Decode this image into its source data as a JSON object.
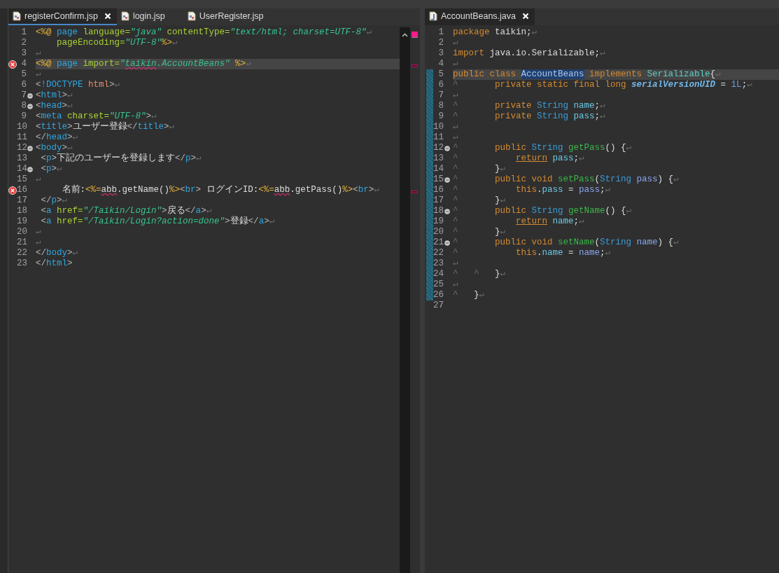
{
  "editors": [
    {
      "focused": true,
      "tabs": [
        {
          "label": "registerConfirm.jsp",
          "kind": "jsp",
          "selected": true
        },
        {
          "label": "login.jsp",
          "kind": "jsp",
          "selected": false
        },
        {
          "label": "UserRegister.jsp",
          "kind": "jsp",
          "selected": false
        }
      ],
      "lines": [
        {
          "number": "1",
          "error": false,
          "fold": false,
          "current": false,
          "tokens": [
            {
              "text": "<%@",
              "kind": "dir"
            },
            {
              "text": " page",
              "kind": "tag"
            },
            {
              "text": " language=",
              "kind": "attr"
            },
            {
              "text": "\"java\"",
              "kind": "value"
            },
            {
              "text": " contentType=",
              "kind": "attr"
            },
            {
              "text": "\"text/html; charset=UTF-8\"",
              "kind": "value"
            },
            {
              "text": "↵",
              "kind": "ws"
            }
          ]
        },
        {
          "number": "2",
          "error": false,
          "fold": false,
          "current": false,
          "tokens": [
            {
              "text": "    pageEncoding=",
              "kind": "attr"
            },
            {
              "text": "\"UTF-8\"",
              "kind": "value"
            },
            {
              "text": "%>",
              "kind": "dir"
            },
            {
              "text": "↵",
              "kind": "ws"
            }
          ]
        },
        {
          "number": "3",
          "error": false,
          "fold": false,
          "current": false,
          "tokens": [
            {
              "text": "↵",
              "kind": "ws"
            }
          ]
        },
        {
          "number": "4",
          "error": true,
          "fold": false,
          "current": true,
          "tokens": [
            {
              "text": "<%@",
              "kind": "dir"
            },
            {
              "text": " page",
              "kind": "tag"
            },
            {
              "text": " import=",
              "kind": "attr"
            },
            {
              "text": "\"",
              "kind": "value"
            },
            {
              "text": "taikin",
              "kind": "value_err"
            },
            {
              "text": ".AccountBeans\"",
              "kind": "value"
            },
            {
              "text": " %>",
              "kind": "dir"
            },
            {
              "text": "↵",
              "kind": "ws"
            }
          ]
        },
        {
          "number": "5",
          "error": false,
          "fold": false,
          "current": false,
          "tokens": [
            {
              "text": "↵",
              "kind": "ws"
            }
          ]
        },
        {
          "number": "6",
          "error": false,
          "fold": false,
          "current": false,
          "tokens": [
            {
              "text": "<",
              "kind": "punct"
            },
            {
              "text": "!DOCTYPE",
              "kind": "tag"
            },
            {
              "text": " html",
              "kind": "doctype"
            },
            {
              "text": ">",
              "kind": "punct"
            },
            {
              "text": "↵",
              "kind": "ws"
            }
          ]
        },
        {
          "number": "7",
          "error": false,
          "fold": true,
          "current": false,
          "tokens": [
            {
              "text": "<",
              "kind": "punct"
            },
            {
              "text": "html",
              "kind": "tag"
            },
            {
              "text": ">",
              "kind": "punct"
            },
            {
              "text": "↵",
              "kind": "ws"
            }
          ]
        },
        {
          "number": "8",
          "error": false,
          "fold": true,
          "current": false,
          "tokens": [
            {
              "text": "<",
              "kind": "punct"
            },
            {
              "text": "head",
              "kind": "tag"
            },
            {
              "text": ">",
              "kind": "punct"
            },
            {
              "text": "↵",
              "kind": "ws"
            }
          ]
        },
        {
          "number": "9",
          "error": false,
          "fold": false,
          "current": false,
          "tokens": [
            {
              "text": "<",
              "kind": "punct"
            },
            {
              "text": "meta",
              "kind": "tag"
            },
            {
              "text": " charset=",
              "kind": "attr"
            },
            {
              "text": "\"UTF-8\"",
              "kind": "value"
            },
            {
              "text": ">",
              "kind": "punct"
            },
            {
              "text": "↵",
              "kind": "ws"
            }
          ]
        },
        {
          "number": "10",
          "error": false,
          "fold": false,
          "current": false,
          "tokens": [
            {
              "text": "<",
              "kind": "punct"
            },
            {
              "text": "title",
              "kind": "tag"
            },
            {
              "text": ">",
              "kind": "punct"
            },
            {
              "text": "ユーザー登録",
              "kind": "plain"
            },
            {
              "text": "</",
              "kind": "punct"
            },
            {
              "text": "title",
              "kind": "tag"
            },
            {
              "text": ">",
              "kind": "punct"
            },
            {
              "text": "↵",
              "kind": "ws"
            }
          ]
        },
        {
          "number": "11",
          "error": false,
          "fold": false,
          "current": false,
          "tokens": [
            {
              "text": "</",
              "kind": "punct"
            },
            {
              "text": "head",
              "kind": "tag"
            },
            {
              "text": ">",
              "kind": "punct"
            },
            {
              "text": "↵",
              "kind": "ws"
            }
          ]
        },
        {
          "number": "12",
          "error": false,
          "fold": true,
          "current": false,
          "tokens": [
            {
              "text": "<",
              "kind": "punct"
            },
            {
              "text": "body",
              "kind": "tag"
            },
            {
              "text": ">",
              "kind": "punct"
            },
            {
              "text": "↵",
              "kind": "ws"
            }
          ]
        },
        {
          "number": "13",
          "error": false,
          "fold": false,
          "current": false,
          "tokens": [
            {
              "text": " <",
              "kind": "punct"
            },
            {
              "text": "p",
              "kind": "tag"
            },
            {
              "text": ">",
              "kind": "punct"
            },
            {
              "text": "下記のユーザーを登録します",
              "kind": "plain"
            },
            {
              "text": "</",
              "kind": "punct"
            },
            {
              "text": "p",
              "kind": "tag"
            },
            {
              "text": ">",
              "kind": "punct"
            },
            {
              "text": "↵",
              "kind": "ws"
            }
          ]
        },
        {
          "number": "14",
          "error": false,
          "fold": true,
          "current": false,
          "tokens": [
            {
              "text": " <",
              "kind": "punct"
            },
            {
              "text": "p",
              "kind": "tag"
            },
            {
              "text": ">",
              "kind": "punct"
            },
            {
              "text": "↵",
              "kind": "ws"
            }
          ]
        },
        {
          "number": "15",
          "error": false,
          "fold": false,
          "current": false,
          "tokens": [
            {
              "text": "↵",
              "kind": "ws"
            }
          ]
        },
        {
          "number": "16",
          "error": true,
          "fold": false,
          "current": false,
          "tokens": [
            {
              "text": "     名前:",
              "kind": "plain"
            },
            {
              "text": "<%=",
              "kind": "dir"
            },
            {
              "text": "abb",
              "kind": "text_err"
            },
            {
              "text": ".getName()",
              "kind": "plain"
            },
            {
              "text": "%>",
              "kind": "dir"
            },
            {
              "text": "<",
              "kind": "punct"
            },
            {
              "text": "br",
              "kind": "tag"
            },
            {
              "text": ">",
              "kind": "punct"
            },
            {
              "text": " ログインID:",
              "kind": "plain"
            },
            {
              "text": "<%=",
              "kind": "dir"
            },
            {
              "text": "abb",
              "kind": "text_err"
            },
            {
              "text": ".getPass()",
              "kind": "plain"
            },
            {
              "text": "%>",
              "kind": "dir"
            },
            {
              "text": "<",
              "kind": "punct"
            },
            {
              "text": "br",
              "kind": "tag"
            },
            {
              "text": ">",
              "kind": "punct"
            },
            {
              "text": "↵",
              "kind": "ws"
            }
          ]
        },
        {
          "number": "17",
          "error": false,
          "fold": false,
          "current": false,
          "tokens": [
            {
              "text": " </",
              "kind": "punct"
            },
            {
              "text": "p",
              "kind": "tag"
            },
            {
              "text": ">",
              "kind": "punct"
            },
            {
              "text": "↵",
              "kind": "ws"
            }
          ]
        },
        {
          "number": "18",
          "error": false,
          "fold": false,
          "current": false,
          "tokens": [
            {
              "text": " <",
              "kind": "punct"
            },
            {
              "text": "a",
              "kind": "tag"
            },
            {
              "text": " href=",
              "kind": "attr"
            },
            {
              "text": "\"/Taikin/Login\"",
              "kind": "value"
            },
            {
              "text": ">",
              "kind": "punct"
            },
            {
              "text": "戻る",
              "kind": "plain"
            },
            {
              "text": "</",
              "kind": "punct"
            },
            {
              "text": "a",
              "kind": "tag"
            },
            {
              "text": ">",
              "kind": "punct"
            },
            {
              "text": "↵",
              "kind": "ws"
            }
          ]
        },
        {
          "number": "19",
          "error": false,
          "fold": false,
          "current": false,
          "tokens": [
            {
              "text": " <",
              "kind": "punct"
            },
            {
              "text": "a",
              "kind": "tag"
            },
            {
              "text": " href=",
              "kind": "attr"
            },
            {
              "text": "\"/Taikin/Login?action=done\"",
              "kind": "value"
            },
            {
              "text": ">",
              "kind": "punct"
            },
            {
              "text": "登録",
              "kind": "plain"
            },
            {
              "text": "</",
              "kind": "punct"
            },
            {
              "text": "a",
              "kind": "tag"
            },
            {
              "text": ">",
              "kind": "punct"
            },
            {
              "text": "↵",
              "kind": "ws"
            }
          ]
        },
        {
          "number": "20",
          "error": false,
          "fold": false,
          "current": false,
          "tokens": [
            {
              "text": "↵",
              "kind": "ws"
            }
          ]
        },
        {
          "number": "21",
          "error": false,
          "fold": false,
          "current": false,
          "tokens": [
            {
              "text": "↵",
              "kind": "ws"
            }
          ]
        },
        {
          "number": "22",
          "error": false,
          "fold": false,
          "current": false,
          "tokens": [
            {
              "text": "</",
              "kind": "punct"
            },
            {
              "text": "body",
              "kind": "tag"
            },
            {
              "text": ">",
              "kind": "punct"
            },
            {
              "text": "↵",
              "kind": "ws"
            }
          ]
        },
        {
          "number": "23",
          "error": false,
          "fold": false,
          "current": false,
          "tokens": [
            {
              "text": "</",
              "kind": "punct"
            },
            {
              "text": "html",
              "kind": "tag"
            },
            {
              "text": ">",
              "kind": "punct"
            }
          ]
        }
      ]
    },
    {
      "focused": false,
      "tabs": [
        {
          "label": "AccountBeans.java",
          "kind": "java",
          "selected": true
        }
      ],
      "lines": [
        {
          "number": "1",
          "fold": false,
          "current": false,
          "changed": false,
          "tokens": [
            {
              "text": "package",
              "kind": "keyword"
            },
            {
              "text": " taikin;",
              "kind": "plain"
            },
            {
              "text": "↵",
              "kind": "ws"
            }
          ]
        },
        {
          "number": "2",
          "fold": false,
          "current": false,
          "changed": false,
          "tokens": [
            {
              "text": "↵",
              "kind": "ws"
            }
          ]
        },
        {
          "number": "3",
          "fold": false,
          "current": false,
          "changed": false,
          "tokens": [
            {
              "text": "import",
              "kind": "keyword"
            },
            {
              "text": " java.io.Serializable;",
              "kind": "plain"
            },
            {
              "text": "↵",
              "kind": "ws"
            }
          ]
        },
        {
          "number": "4",
          "fold": false,
          "current": false,
          "changed": false,
          "tokens": [
            {
              "text": "↵",
              "kind": "ws"
            }
          ]
        },
        {
          "number": "5",
          "fold": false,
          "current": true,
          "changed": true,
          "tokens": [
            {
              "text": "public class ",
              "kind": "keyword"
            },
            {
              "text": "AccountBeans",
              "kind": "occurrence"
            },
            {
              "text": " implements ",
              "kind": "keyword"
            },
            {
              "text": "Serializable",
              "kind": "classref"
            },
            {
              "text": "{",
              "kind": "plain"
            },
            {
              "text": "↵",
              "kind": "ws"
            }
          ]
        },
        {
          "number": "6",
          "fold": false,
          "current": false,
          "changed": true,
          "tokens": [
            {
              "text": "^       ",
              "kind": "ws"
            },
            {
              "text": "private static final long ",
              "kind": "keyword"
            },
            {
              "text": "serialVersionUID",
              "kind": "static"
            },
            {
              "text": " = ",
              "kind": "plain"
            },
            {
              "text": "1L",
              "kind": "number"
            },
            {
              "text": ";",
              "kind": "plain"
            },
            {
              "text": "↵",
              "kind": "ws"
            }
          ]
        },
        {
          "number": "7",
          "fold": false,
          "current": false,
          "changed": true,
          "tokens": [
            {
              "text": "↵",
              "kind": "ws"
            }
          ]
        },
        {
          "number": "8",
          "fold": false,
          "current": false,
          "changed": true,
          "tokens": [
            {
              "text": "^       ",
              "kind": "ws"
            },
            {
              "text": "private ",
              "kind": "keyword"
            },
            {
              "text": "String ",
              "kind": "type"
            },
            {
              "text": "name",
              "kind": "field"
            },
            {
              "text": ";",
              "kind": "plain"
            },
            {
              "text": "↵",
              "kind": "ws"
            }
          ]
        },
        {
          "number": "9",
          "fold": false,
          "current": false,
          "changed": true,
          "tokens": [
            {
              "text": "^       ",
              "kind": "ws"
            },
            {
              "text": "private ",
              "kind": "keyword"
            },
            {
              "text": "String ",
              "kind": "type"
            },
            {
              "text": "pass",
              "kind": "field"
            },
            {
              "text": ";",
              "kind": "plain"
            },
            {
              "text": "↵",
              "kind": "ws"
            }
          ]
        },
        {
          "number": "10",
          "fold": false,
          "current": false,
          "changed": true,
          "tokens": [
            {
              "text": "↵",
              "kind": "ws"
            }
          ]
        },
        {
          "number": "11",
          "fold": false,
          "current": false,
          "changed": true,
          "tokens": [
            {
              "text": "↵",
              "kind": "ws"
            }
          ]
        },
        {
          "number": "12",
          "fold": true,
          "current": false,
          "changed": true,
          "tokens": [
            {
              "text": "^       ",
              "kind": "ws"
            },
            {
              "text": "public ",
              "kind": "keyword"
            },
            {
              "text": "String ",
              "kind": "type"
            },
            {
              "text": "getPass",
              "kind": "method"
            },
            {
              "text": "() {",
              "kind": "plain"
            },
            {
              "text": "↵",
              "kind": "ws"
            }
          ]
        },
        {
          "number": "13",
          "fold": false,
          "current": false,
          "changed": true,
          "tokens": [
            {
              "text": "^           ",
              "kind": "ws"
            },
            {
              "text": "return",
              "kind": "keyword_mark"
            },
            {
              "text": " pass",
              "kind": "field"
            },
            {
              "text": ";",
              "kind": "plain"
            },
            {
              "text": "↵",
              "kind": "ws"
            }
          ]
        },
        {
          "number": "14",
          "fold": false,
          "current": false,
          "changed": true,
          "tokens": [
            {
              "text": "^       ",
              "kind": "ws"
            },
            {
              "text": "}",
              "kind": "plain"
            },
            {
              "text": "↵",
              "kind": "ws"
            }
          ]
        },
        {
          "number": "15",
          "fold": true,
          "current": false,
          "changed": true,
          "tokens": [
            {
              "text": "^       ",
              "kind": "ws"
            },
            {
              "text": "public void ",
              "kind": "keyword"
            },
            {
              "text": "setPass",
              "kind": "method"
            },
            {
              "text": "(",
              "kind": "plain"
            },
            {
              "text": "String",
              "kind": "type"
            },
            {
              "text": " pass",
              "kind": "param"
            },
            {
              "text": ") {",
              "kind": "plain"
            },
            {
              "text": "↵",
              "kind": "ws"
            }
          ]
        },
        {
          "number": "16",
          "fold": false,
          "current": false,
          "changed": true,
          "tokens": [
            {
              "text": "^           ",
              "kind": "ws"
            },
            {
              "text": "this",
              "kind": "keyword"
            },
            {
              "text": ".",
              "kind": "plain"
            },
            {
              "text": "pass",
              "kind": "field"
            },
            {
              "text": " = ",
              "kind": "plain"
            },
            {
              "text": "pass",
              "kind": "param"
            },
            {
              "text": ";",
              "kind": "plain"
            },
            {
              "text": "↵",
              "kind": "ws"
            }
          ]
        },
        {
          "number": "17",
          "fold": false,
          "current": false,
          "changed": true,
          "tokens": [
            {
              "text": "^       ",
              "kind": "ws"
            },
            {
              "text": "}",
              "kind": "plain"
            },
            {
              "text": "↵",
              "kind": "ws"
            }
          ]
        },
        {
          "number": "18",
          "fold": true,
          "current": false,
          "changed": true,
          "tokens": [
            {
              "text": "^       ",
              "kind": "ws"
            },
            {
              "text": "public ",
              "kind": "keyword"
            },
            {
              "text": "String ",
              "kind": "type"
            },
            {
              "text": "getName",
              "kind": "method"
            },
            {
              "text": "() {",
              "kind": "plain"
            },
            {
              "text": "↵",
              "kind": "ws"
            }
          ]
        },
        {
          "number": "19",
          "fold": false,
          "current": false,
          "changed": true,
          "tokens": [
            {
              "text": "^           ",
              "kind": "ws"
            },
            {
              "text": "return",
              "kind": "keyword_mark"
            },
            {
              "text": " name",
              "kind": "field"
            },
            {
              "text": ";",
              "kind": "plain"
            },
            {
              "text": "↵",
              "kind": "ws"
            }
          ]
        },
        {
          "number": "20",
          "fold": false,
          "current": false,
          "changed": true,
          "tokens": [
            {
              "text": "^       ",
              "kind": "ws"
            },
            {
              "text": "}",
              "kind": "plain"
            },
            {
              "text": "↵",
              "kind": "ws"
            }
          ]
        },
        {
          "number": "21",
          "fold": true,
          "current": false,
          "changed": true,
          "tokens": [
            {
              "text": "^       ",
              "kind": "ws"
            },
            {
              "text": "public void ",
              "kind": "keyword"
            },
            {
              "text": "setName",
              "kind": "method"
            },
            {
              "text": "(",
              "kind": "plain"
            },
            {
              "text": "String",
              "kind": "type"
            },
            {
              "text": " name",
              "kind": "param"
            },
            {
              "text": ") {",
              "kind": "plain"
            },
            {
              "text": "↵",
              "kind": "ws"
            }
          ]
        },
        {
          "number": "22",
          "fold": false,
          "current": false,
          "changed": true,
          "tokens": [
            {
              "text": "^           ",
              "kind": "ws"
            },
            {
              "text": "this",
              "kind": "keyword"
            },
            {
              "text": ".",
              "kind": "plain"
            },
            {
              "text": "name",
              "kind": "field"
            },
            {
              "text": " = ",
              "kind": "plain"
            },
            {
              "text": "name",
              "kind": "param"
            },
            {
              "text": ";",
              "kind": "plain"
            },
            {
              "text": "↵",
              "kind": "ws"
            }
          ]
        },
        {
          "number": "23",
          "fold": false,
          "current": false,
          "changed": true,
          "tokens": [
            {
              "text": "↵",
              "kind": "ws"
            }
          ]
        },
        {
          "number": "24",
          "fold": false,
          "current": false,
          "changed": true,
          "tokens": [
            {
              "text": "^   ^   ",
              "kind": "ws"
            },
            {
              "text": "}",
              "kind": "plain"
            },
            {
              "text": "↵",
              "kind": "ws"
            }
          ]
        },
        {
          "number": "25",
          "fold": false,
          "current": false,
          "changed": true,
          "tokens": [
            {
              "text": "↵",
              "kind": "ws"
            }
          ]
        },
        {
          "number": "26",
          "fold": false,
          "current": false,
          "changed": true,
          "tokens": [
            {
              "text": "^   ",
              "kind": "ws"
            },
            {
              "text": "}",
              "kind": "plain"
            },
            {
              "text": "↵",
              "kind": "ws"
            }
          ]
        },
        {
          "number": "27",
          "fold": false,
          "current": false,
          "changed": false
        }
      ]
    }
  ]
}
